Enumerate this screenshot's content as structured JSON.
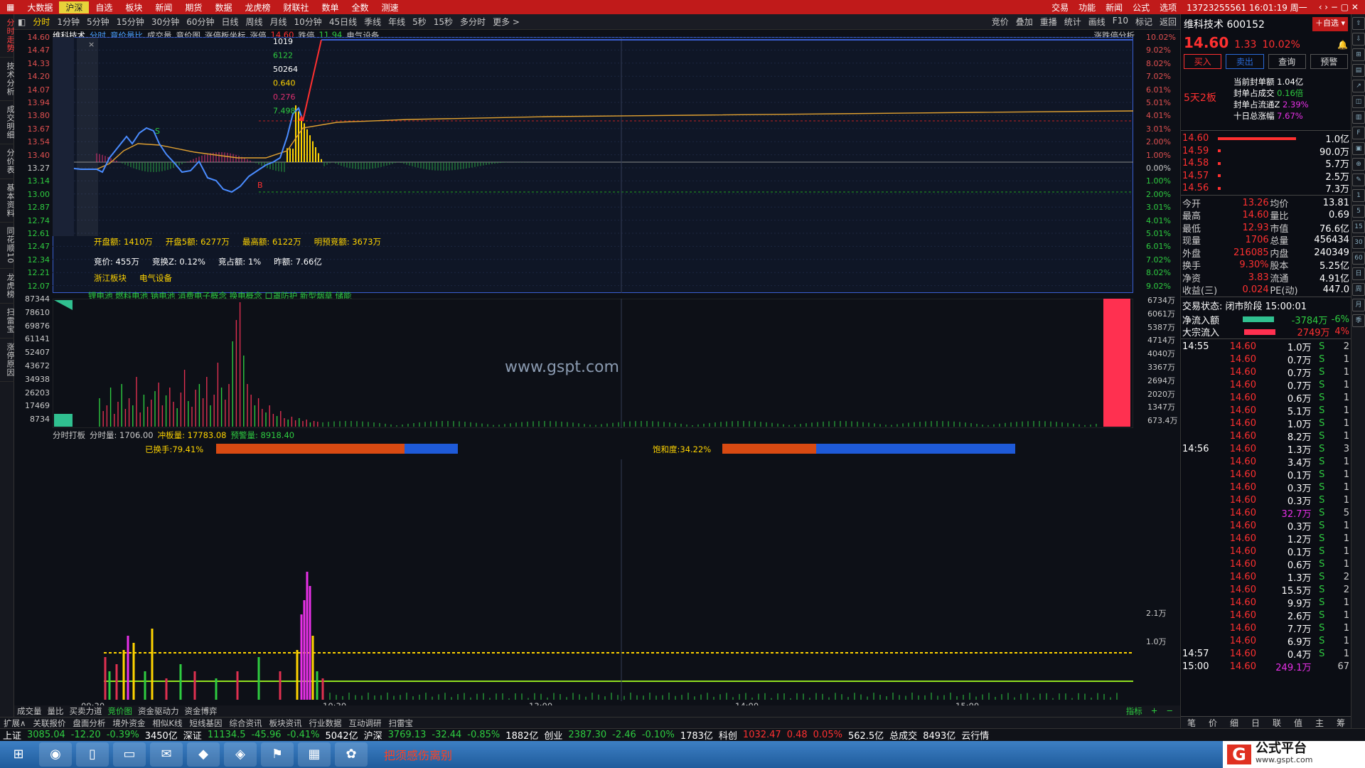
{
  "topmenu": [
    "大数据",
    "沪深",
    "自选",
    "板块",
    "新闻",
    "期货",
    "数据",
    "龙虎榜",
    "财联社",
    "数单",
    "全数",
    "测速"
  ],
  "topright": [
    "交易",
    "功能",
    "新闻",
    "公式",
    "选项",
    "13723255561 16:01:19 周一"
  ],
  "leftnav": [
    "分时走势",
    "技术分析",
    "成交明细",
    "分价表",
    "基本资料",
    "同花顺10",
    "龙虎榜",
    "扫雷宝",
    "涨停原因"
  ],
  "periods": [
    "分时",
    "1分钟",
    "5分钟",
    "15分钟",
    "30分钟",
    "60分钟",
    "日线",
    "周线",
    "月线",
    "10分钟",
    "45日线",
    "季线",
    "年线",
    "5秒",
    "15秒",
    "多分时",
    "更多 >"
  ],
  "periods_right": [
    "竞价",
    "叠加",
    "重播",
    "统计",
    "画线",
    "F10",
    "标记",
    "返回"
  ],
  "header": {
    "stock": "维科技术",
    "tabs": [
      "分时",
      "竞价量比",
      "成交量",
      "竞价图",
      "涨停板坐标"
    ],
    "zt_label": "涨停",
    "zt": "14.60",
    "dt_label": "跌停",
    "dt": "11.94",
    "sector": "电气设备",
    "right": "涨跌停分析"
  },
  "price_axis": [
    "14.60",
    "14.47",
    "14.33",
    "14.20",
    "14.07",
    "13.94",
    "13.80",
    "13.67",
    "13.54",
    "13.40",
    "13.27",
    "13.14",
    "13.00",
    "12.87",
    "12.74",
    "12.61",
    "12.47",
    "12.34",
    "12.21",
    "12.07"
  ],
  "pct_axis": [
    "10.02%",
    "9.02%",
    "8.02%",
    "7.02%",
    "6.01%",
    "5.01%",
    "4.01%",
    "3.01%",
    "2.00%",
    "1.00%",
    "0.00%",
    "1.00%",
    "2.00%",
    "3.01%",
    "4.01%",
    "5.01%",
    "6.01%",
    "7.02%",
    "8.02%",
    "9.02%"
  ],
  "auction_labels": [
    "1019",
    "6122",
    "50264",
    "0.640",
    "0.276",
    "7.498"
  ],
  "info1": [
    "开盘额: 1410万",
    "开盘5额: 6277万",
    "最高额: 6122万",
    "明预竞额: 3673万"
  ],
  "info2": [
    "竞价: 455万",
    "竞换Z: 0.12%",
    "竞占额: 1%",
    "昨额: 7.66亿"
  ],
  "info3": [
    "浙江板块",
    "电气设备"
  ],
  "concepts": "锂电池 燃料电池 钠电池 消费电子概念 换电概念 口罩防护 新型烟草 储能",
  "vol_axis_l": [
    "87344",
    "78610",
    "69876",
    "61141",
    "52407",
    "43672",
    "34938",
    "26203",
    "17469",
    "8734"
  ],
  "vol_axis_r": [
    "6734万",
    "6061万",
    "5387万",
    "4714万",
    "4040万",
    "3367万",
    "2694万",
    "2020万",
    "1347万",
    "673.4万"
  ],
  "watermark": "www.gspt.com",
  "panel3": {
    "title": "分时打板",
    "fsl": "分时量: 1706.00",
    "cfl": "冲板量: 17783.08",
    "yjl": "预警量: 8918.40",
    "hs": "已换手:79.41%",
    "bhd": "饱和度:34.22%",
    "r1": "2.1万",
    "r2": "1.0万"
  },
  "time_axis": [
    "09:30",
    "10:30",
    "13:00",
    "14:00",
    "15:00"
  ],
  "bottom_tabs": [
    "成交量",
    "量比",
    "买卖力道",
    "竞价图",
    "资金驱动力",
    "资金博弈"
  ],
  "bottom_right": [
    "指标",
    "+",
    "−"
  ],
  "bottom2": [
    "扩展∧",
    "关联报价",
    "盘面分析",
    "境外资金",
    "相似K线",
    "短线基因",
    "综合资讯",
    "板块资讯",
    "行业数据",
    "互动调研",
    "扫雷宝"
  ],
  "status": [
    [
      "上证",
      "3085.04",
      "-12.20",
      "-0.39%",
      "3450亿"
    ],
    [
      "深证",
      "11134.5",
      "-45.96",
      "-0.41%",
      "5042亿"
    ],
    [
      "沪深",
      "3769.13",
      "-32.44",
      "-0.85%",
      "1882亿"
    ],
    [
      "创业",
      "2387.30",
      "-2.46",
      "-0.10%",
      "1783亿"
    ],
    [
      "科创",
      "1032.47",
      "0.48",
      "0.05%",
      "562.5亿"
    ]
  ],
  "status_extra": [
    "总成交",
    "8493亿",
    "云行情"
  ],
  "right": {
    "title": "维科技术 600152",
    "price": "14.60",
    "chg": "1.33",
    "pct": "10.02%",
    "btns": [
      "买入",
      "卖出",
      "查询",
      "预警"
    ],
    "tag": "5天2板",
    "seal": [
      [
        "当前封单额",
        "1.04亿"
      ],
      [
        "封单占成交",
        "0.16倍"
      ],
      [
        "封单占流通Z",
        "2.39%"
      ],
      [
        "十日总涨幅",
        "7.67%"
      ]
    ],
    "book": [
      [
        "14.60",
        "1.0亿"
      ],
      [
        "14.59",
        "90.0万"
      ],
      [
        "14.58",
        "5.7万"
      ],
      [
        "14.57",
        "2.5万"
      ],
      [
        "14.56",
        "7.3万"
      ]
    ],
    "stats": [
      [
        "今开",
        "13.26",
        "均价",
        "13.81"
      ],
      [
        "最高",
        "14.60",
        "量比",
        "0.69"
      ],
      [
        "最低",
        "12.93",
        "市值",
        "76.6亿"
      ],
      [
        "现量",
        "1706",
        "总量",
        "456434"
      ],
      [
        "外盘",
        "216085",
        "内盘",
        "240349"
      ],
      [
        "换手",
        "9.30%",
        "股本",
        "5.25亿"
      ],
      [
        "净资",
        "3.83",
        "流通",
        "4.91亿"
      ],
      [
        "收益(三)",
        "0.024",
        "PE(动)",
        "447.0"
      ]
    ],
    "state": "交易状态: 闭市阶段 15:00:01",
    "flows": [
      [
        "净流入额",
        "-3784万",
        "-6%"
      ],
      [
        "大宗流入",
        "2749万",
        "4%"
      ]
    ],
    "ticks": [
      [
        "14:55",
        "14.60",
        "1.0万",
        "S",
        "2"
      ],
      [
        "",
        "14.60",
        "0.7万",
        "S",
        "1"
      ],
      [
        "",
        "14.60",
        "0.7万",
        "S",
        "1"
      ],
      [
        "",
        "14.60",
        "0.7万",
        "S",
        "1"
      ],
      [
        "",
        "14.60",
        "0.6万",
        "S",
        "1"
      ],
      [
        "",
        "14.60",
        "5.1万",
        "S",
        "1"
      ],
      [
        "",
        "14.60",
        "1.0万",
        "S",
        "1"
      ],
      [
        "",
        "14.60",
        "8.2万",
        "S",
        "1"
      ],
      [
        "14:56",
        "14.60",
        "1.3万",
        "S",
        "3"
      ],
      [
        "",
        "14.60",
        "3.4万",
        "S",
        "1"
      ],
      [
        "",
        "14.60",
        "0.1万",
        "S",
        "1"
      ],
      [
        "",
        "14.60",
        "0.3万",
        "S",
        "1"
      ],
      [
        "",
        "14.60",
        "0.3万",
        "S",
        "1"
      ],
      [
        "",
        "14.60",
        "32.7万",
        "S",
        "5"
      ],
      [
        "",
        "14.60",
        "0.3万",
        "S",
        "1"
      ],
      [
        "",
        "14.60",
        "1.2万",
        "S",
        "1"
      ],
      [
        "",
        "14.60",
        "0.1万",
        "S",
        "1"
      ],
      [
        "",
        "14.60",
        "0.6万",
        "S",
        "1"
      ],
      [
        "",
        "14.60",
        "1.3万",
        "S",
        "2"
      ],
      [
        "",
        "14.60",
        "15.5万",
        "S",
        "2"
      ],
      [
        "",
        "14.60",
        "9.9万",
        "S",
        "1"
      ],
      [
        "",
        "14.60",
        "2.6万",
        "S",
        "1"
      ],
      [
        "",
        "14.60",
        "7.7万",
        "S",
        "1"
      ],
      [
        "",
        "14.60",
        "6.9万",
        "S",
        "1"
      ],
      [
        "14:57",
        "14.60",
        "0.4万",
        "S",
        "1"
      ],
      [
        "15:00",
        "14.60",
        "249.1万",
        "",
        "67"
      ]
    ],
    "bottom": [
      "笔",
      "价",
      "细",
      "日",
      "联",
      "值",
      "主",
      "筹"
    ]
  },
  "taskbar_text": "把须感伤离别",
  "brand": "公式平台",
  "brand_url": "www.gspt.com"
}
